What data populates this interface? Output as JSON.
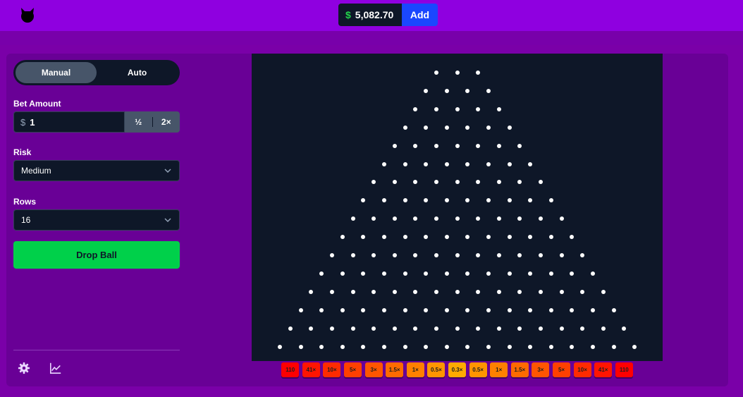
{
  "header": {
    "logo_icon": "devil-head-icon",
    "balance": {
      "currency": "$",
      "amount": "5,082.70"
    },
    "add_label": "Add"
  },
  "sidebar": {
    "tabs": [
      {
        "label": "Manual",
        "active": true
      },
      {
        "label": "Auto",
        "active": false
      }
    ],
    "bet": {
      "label": "Bet Amount",
      "currency": "$",
      "value": "1",
      "half_label": "½",
      "double_label": "2×"
    },
    "risk": {
      "label": "Risk",
      "value": "Medium"
    },
    "rows": {
      "label": "Rows",
      "value": "16"
    },
    "drop_label": "Drop Ball",
    "footer_icons": [
      "settings-gear-icon",
      "line-chart-icon"
    ]
  },
  "board": {
    "rows": 16,
    "multipliers": [
      "110",
      "41×",
      "10×",
      "5×",
      "3×",
      "1.5×",
      "1×",
      "0.5×",
      "0.3×",
      "0.5×",
      "1×",
      "1.5×",
      "3×",
      "5×",
      "10×",
      "41×",
      "110"
    ],
    "bucket_colors": [
      "#ff0000",
      "#ff1500",
      "#ff2b00",
      "#ff4000",
      "#ff5500",
      "#ff6a00",
      "#ff8000",
      "#ff9500",
      "#ffaa00",
      "#ff9500",
      "#ff8000",
      "#ff6a00",
      "#ff5500",
      "#ff4000",
      "#ff2b00",
      "#ff1500",
      "#ff0000"
    ]
  }
}
